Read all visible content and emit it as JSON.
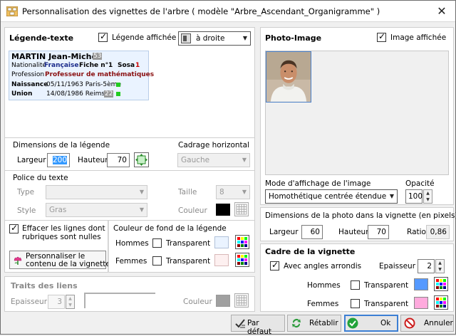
{
  "window": {
    "title": "Personnalisation des vignettes de l'arbre ( modèle \"Arbre_Ascendant_Organigramme\" )",
    "close_glyph": "✕"
  },
  "legend": {
    "title": "Légende-texte",
    "show_label": "Légende affichée",
    "position_value": "à droite",
    "preview": {
      "name": "MARTIN Jean-Michel",
      "name_badge": "53",
      "nat_label": "Nationalité",
      "nat_value": "Française",
      "fiche_label": "Fiche n°",
      "fiche_value": "1",
      "sosa_label": "Sosa",
      "sosa_value": "1",
      "prof_label": "Profession",
      "prof_value": "Professeur de mathématiques",
      "birth_label": "Naissance",
      "birth_value": "05/11/1963 Paris-5ème",
      "union_label": "Union",
      "union_value": "14/08/1986 Reims",
      "union_badge": "22"
    }
  },
  "dims": {
    "title": "Dimensions de la légende",
    "width_label": "Largeur",
    "width_value": "200",
    "height_label": "Hauteur",
    "height_value": "70",
    "frame_title": "Cadrage horizontal",
    "frame_value": "Gauche"
  },
  "font": {
    "title": "Police du texte",
    "type_label": "Type",
    "type_value": "",
    "size_label": "Taille",
    "size_value": "8",
    "style_label": "Style",
    "style_value": "Gras",
    "color_label": "Couleur",
    "color": "#000000"
  },
  "erase": {
    "label_line1": "Effacer les lignes dont les",
    "label_line2": "rubriques sont nulles",
    "custom_btn_line1": "Personnaliser le",
    "custom_btn_line2": "contenu de la vignette"
  },
  "bg": {
    "title": "Couleur de fond de la légende",
    "men_label": "Hommes",
    "women_label": "Femmes",
    "transparent_label": "Transparent",
    "men_color": "#eaf3ff",
    "women_color": "#fdf0f0"
  },
  "links": {
    "title": "Traits des liens",
    "thickness_label": "Epaisseur",
    "thickness_value": "3",
    "color_label": "Couleur",
    "color": "#a0a0a0"
  },
  "photo": {
    "title": "Photo-Image",
    "show_label": "Image affichée",
    "mode_label": "Mode d'affichage de l'image",
    "mode_value": "Homothétique centrée étendue",
    "opacity_label": "Opacité",
    "opacity_value": "100"
  },
  "photo_dims": {
    "title": "Dimensions de la photo dans la vignette (en pixels)",
    "width_label": "Largeur",
    "width_value": "60",
    "height_label": "Hauteur",
    "height_value": "70",
    "ratio_label": "Ratio",
    "ratio_value": "0,86"
  },
  "frame": {
    "title": "Cadre de la vignette",
    "rounded_label": "Avec angles arrondis",
    "thickness_label": "Epaisseur",
    "thickness_value": "2",
    "men_label": "Hommes",
    "women_label": "Femmes",
    "transparent_label": "Transparent",
    "men_color": "#5599ff",
    "women_color": "#ffaadd"
  },
  "buttons": {
    "default": "Par défaut",
    "restore": "Rétablir",
    "ok": "Ok",
    "cancel": "Annuler"
  }
}
